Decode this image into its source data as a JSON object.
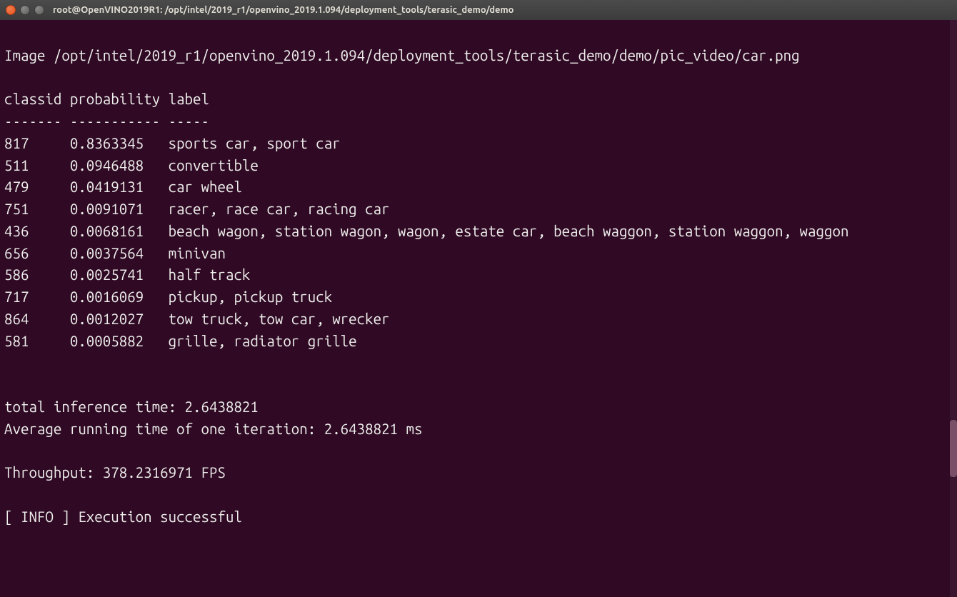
{
  "titlebar": {
    "title": "root@OpenVINO2019R1: /opt/intel/2019_r1/openvino_2019.1.094/deployment_tools/terasic_demo/demo"
  },
  "terminal": {
    "blank_head": "",
    "image_line": "Image /opt/intel/2019_r1/openvino_2019.1.094/deployment_tools/terasic_demo/demo/pic_video/car.png",
    "blank1": "",
    "header": "classid probability label",
    "divider": "------- ----------- -----",
    "rows": [
      "817     0.8363345   sports car, sport car",
      "511     0.0946488   convertible",
      "479     0.0419131   car wheel",
      "751     0.0091071   racer, race car, racing car",
      "436     0.0068161   beach wagon, station wagon, wagon, estate car, beach waggon, station waggon, waggon",
      "656     0.0037564   minivan",
      "586     0.0025741   half track",
      "717     0.0016069   pickup, pickup truck",
      "864     0.0012027   tow truck, tow car, wrecker",
      "581     0.0005882   grille, radiator grille"
    ],
    "blank2": "",
    "blank3": "",
    "total_time": "total inference time: 2.6438821",
    "avg_time": "Average running time of one iteration: 2.6438821 ms",
    "blank4": "",
    "throughput": "Throughput: 378.2316971 FPS",
    "blank5": "",
    "info_line": "[ INFO ] Execution successful"
  }
}
